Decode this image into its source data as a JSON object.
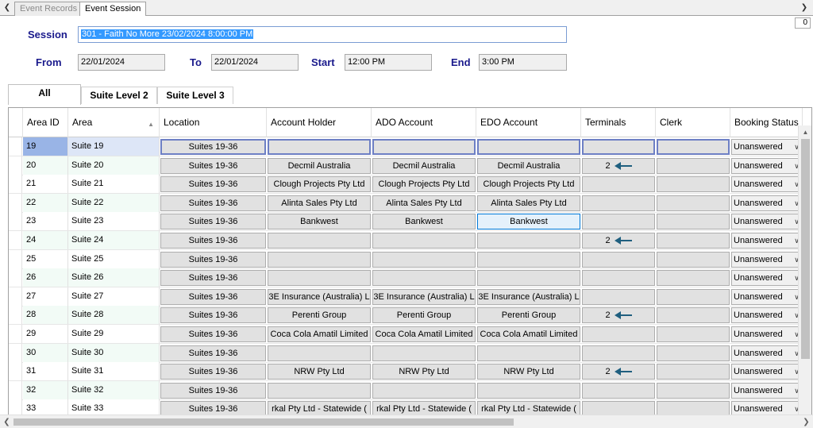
{
  "doc_tabs": [
    "Event Records",
    "Event Session"
  ],
  "counter": "0",
  "form": {
    "session_label": "Session",
    "session_value": "301 - Faith No More 23/02/2024 8:00:00 PM",
    "from_label": "From",
    "from_value": "22/01/2024",
    "to_label": "To",
    "to_value": "22/01/2024",
    "start_label": "Start",
    "start_value": "12:00 PM",
    "end_label": "End",
    "end_value": "3:00 PM"
  },
  "area_tabs": [
    "All",
    "Suite Level 2",
    "Suite Level 3"
  ],
  "columns": [
    "Area ID",
    "Area",
    "Location",
    "Account Holder",
    "ADO Account",
    "EDO Account",
    "Terminals",
    "Clerk",
    "Booking Status"
  ],
  "rows": [
    {
      "id": "19",
      "area": "Suite 19",
      "location": "Suites 19-36",
      "holder": "",
      "ado": "",
      "edo": "",
      "terminals": "",
      "status": "Unanswered"
    },
    {
      "id": "20",
      "area": "Suite 20",
      "location": "Suites 19-36",
      "holder": "Decmil Australia",
      "ado": "Decmil Australia",
      "edo": "Decmil Australia",
      "terminals": "2",
      "status": "Unanswered"
    },
    {
      "id": "21",
      "area": "Suite 21",
      "location": "Suites 19-36",
      "holder": "Clough Projects Pty Ltd",
      "ado": "Clough Projects Pty Ltd",
      "edo": "Clough Projects Pty Ltd",
      "terminals": "",
      "status": "Unanswered"
    },
    {
      "id": "22",
      "area": "Suite 22",
      "location": "Suites 19-36",
      "holder": "Alinta Sales Pty Ltd",
      "ado": "Alinta Sales Pty Ltd",
      "edo": "Alinta Sales Pty Ltd",
      "terminals": "",
      "status": "Unanswered"
    },
    {
      "id": "23",
      "area": "Suite 23",
      "location": "Suites 19-36",
      "holder": "Bankwest",
      "ado": "Bankwest",
      "edo": "Bankwest",
      "terminals": "",
      "status": "Unanswered"
    },
    {
      "id": "24",
      "area": "Suite 24",
      "location": "Suites 19-36",
      "holder": "",
      "ado": "",
      "edo": "",
      "terminals": "2",
      "status": "Unanswered"
    },
    {
      "id": "25",
      "area": "Suite 25",
      "location": "Suites 19-36",
      "holder": "",
      "ado": "",
      "edo": "",
      "terminals": "",
      "status": "Unanswered"
    },
    {
      "id": "26",
      "area": "Suite 26",
      "location": "Suites 19-36",
      "holder": "",
      "ado": "",
      "edo": "",
      "terminals": "",
      "status": "Unanswered"
    },
    {
      "id": "27",
      "area": "Suite 27",
      "location": "Suites 19-36",
      "holder": "3E Insurance (Australia) L",
      "ado": "3E Insurance (Australia) L",
      "edo": "3E Insurance (Australia) L",
      "terminals": "",
      "status": "Unanswered"
    },
    {
      "id": "28",
      "area": "Suite 28",
      "location": "Suites 19-36",
      "holder": "Perenti Group",
      "ado": "Perenti Group",
      "edo": "Perenti Group",
      "terminals": "2",
      "status": "Unanswered"
    },
    {
      "id": "29",
      "area": "Suite 29",
      "location": "Suites 19-36",
      "holder": "Coca Cola Amatil Limited",
      "ado": "Coca Cola Amatil Limited",
      "edo": "Coca Cola Amatil Limited",
      "terminals": "",
      "status": "Unanswered"
    },
    {
      "id": "30",
      "area": "Suite 30",
      "location": "Suites 19-36",
      "holder": "",
      "ado": "",
      "edo": "",
      "terminals": "",
      "status": "Unanswered"
    },
    {
      "id": "31",
      "area": "Suite 31",
      "location": "Suites 19-36",
      "holder": "NRW Pty Ltd",
      "ado": "NRW Pty Ltd",
      "edo": "NRW Pty Ltd",
      "terminals": "2",
      "status": "Unanswered"
    },
    {
      "id": "32",
      "area": "Suite 32",
      "location": "Suites 19-36",
      "holder": "",
      "ado": "",
      "edo": "",
      "terminals": "",
      "status": "Unanswered"
    },
    {
      "id": "33",
      "area": "Suite 33",
      "location": "Suites 19-36",
      "holder": "rkal Pty Ltd - Statewide (",
      "ado": "rkal Pty Ltd - Statewide (",
      "edo": "rkal Pty Ltd - Statewide (",
      "terminals": "",
      "status": "Unanswered"
    }
  ],
  "colors": {
    "label_blue": "#1a1a8c",
    "selection_blue": "#3399ff",
    "row_tint": "#f2fbf6",
    "selected_row": "#dde6f7",
    "id_selected": "#99b4e6"
  }
}
